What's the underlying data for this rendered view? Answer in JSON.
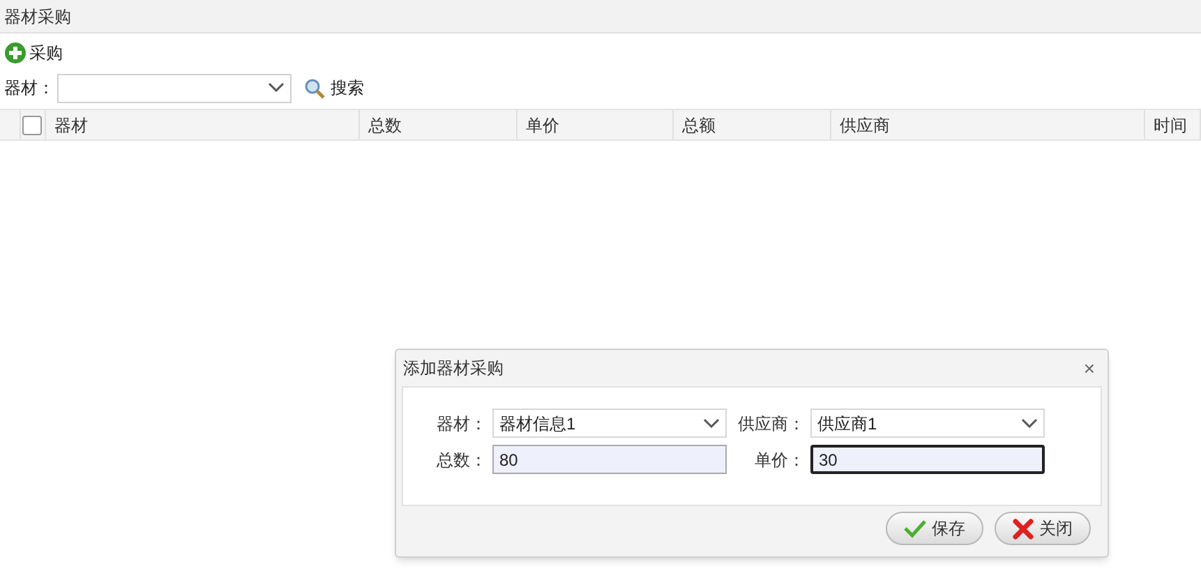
{
  "panel": {
    "title": "器材采购"
  },
  "toolbar": {
    "add_button": "采购"
  },
  "search": {
    "label": "器材：",
    "button": "搜索"
  },
  "table": {
    "select_all_checked": false,
    "columns": [
      "器材",
      "总数",
      "单价",
      "总额",
      "供应商",
      "时间"
    ]
  },
  "dialog": {
    "title": "添加器材采购",
    "close": "×",
    "fields": [
      {
        "kind": "select",
        "label": "器材：",
        "value": "器材信息1"
      },
      {
        "kind": "select",
        "label": "供应商：",
        "value": "供应商1"
      },
      {
        "kind": "text",
        "label": "总数：",
        "value": "80",
        "focused": false
      },
      {
        "kind": "text",
        "label": "单价：",
        "value": "30",
        "focused": true
      }
    ],
    "buttons": [
      {
        "kind": "save",
        "label": "保存"
      },
      {
        "kind": "close",
        "label": "关闭"
      }
    ]
  }
}
